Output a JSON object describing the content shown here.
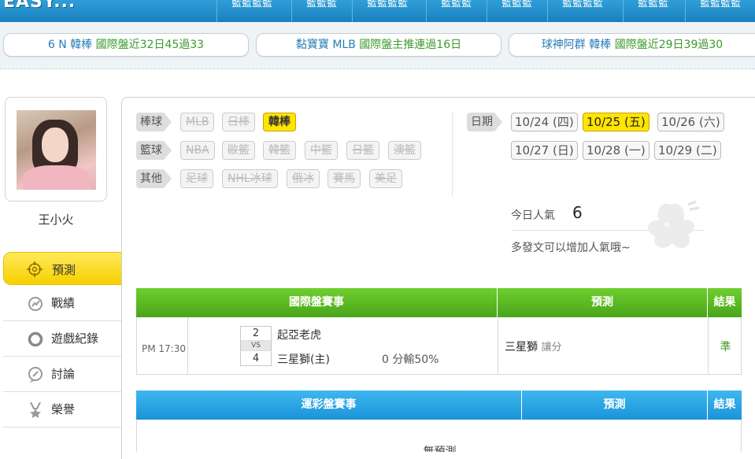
{
  "nav": {
    "logo": "EASY...",
    "items": [
      "籃籃籃籃",
      "籃籃籃",
      "籃籃籃籃",
      "籃籃籃",
      "籃籃籃",
      "籃籃籃籃",
      "籃籃籃",
      "籃籃籃籃"
    ]
  },
  "tickers": [
    {
      "prefix": "6 N  韓棒  ",
      "highlight": "國際盤近32日45過33"
    },
    {
      "prefix": "黏寶寶  MLB  ",
      "highlight": "國際盤主推連過16日"
    },
    {
      "prefix": "球神阿群  韓棒  ",
      "highlight": "國際盤近29日39過30"
    }
  ],
  "user": {
    "name": "王小火"
  },
  "side_menu": [
    "預測",
    "戰績",
    "遊戲紀錄",
    "討論",
    "榮譽"
  ],
  "filters": {
    "baseball": {
      "label": "棒球",
      "items": [
        "MLB",
        "日棒",
        "韓棒"
      ],
      "active": "韓棒"
    },
    "basketball": {
      "label": "籃球",
      "items": [
        "NBA",
        "歐籃",
        "韓籃",
        "中籃",
        "日籃",
        "澳籃"
      ]
    },
    "other": {
      "label": "其他",
      "items": [
        "足球",
        "NHL冰球",
        "俄冰",
        "賽馬",
        "美足"
      ]
    }
  },
  "dates": {
    "label": "日期",
    "items": [
      "10/24 (四)",
      "10/25 (五)",
      "10/26 (六)",
      "10/27 (日)",
      "10/28 (一)",
      "10/29 (二)"
    ],
    "active": "10/25 (五)"
  },
  "popularity": {
    "label": "今日人氣",
    "value": "6",
    "hint": "多發文可以增加人氣哦~"
  },
  "intl_table": {
    "headers": [
      "國際盤賽事",
      "預測",
      "結果"
    ],
    "row": {
      "time": "PM 17:30",
      "away_score": "2",
      "vs": "VS",
      "home_score": "4",
      "away_team": "起亞老虎",
      "home_team": "三星獅(主)",
      "handicap": "0 分輸50%",
      "prediction_team": "三星獅",
      "prediction_type": "讓分",
      "result": "準"
    }
  },
  "lottery_table": {
    "headers": [
      "運彩盤賽事",
      "預測",
      "結果"
    ],
    "empty": "無預測"
  },
  "colors": {
    "accent_yellow": "#ffe400",
    "green_header": "#5bb823",
    "blue_header": "#22a0e0",
    "ticker_text": "#2a7db5"
  }
}
